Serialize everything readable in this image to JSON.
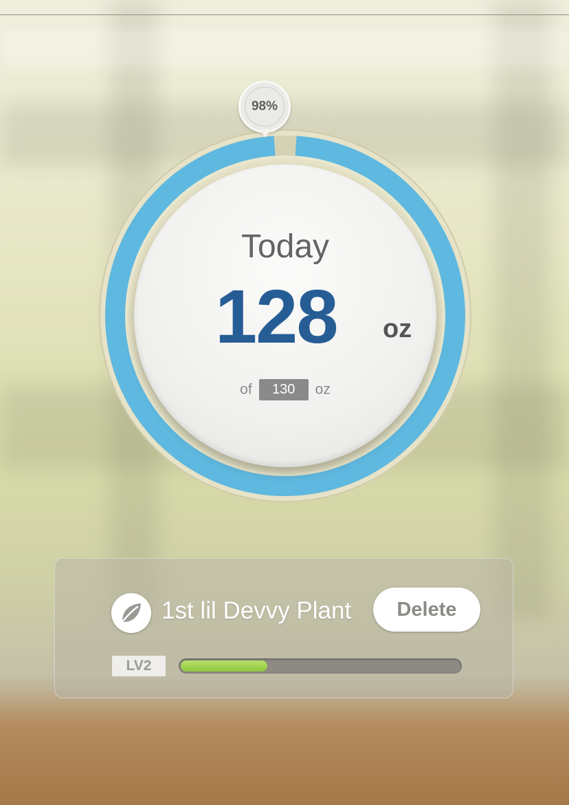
{
  "tracker": {
    "period_label": "Today",
    "amount": "128",
    "unit": "oz",
    "goal_prefix": "of",
    "goal": "130",
    "goal_unit": "oz",
    "percent_label": "98%",
    "progress_fraction": 0.98
  },
  "plant": {
    "icon": "leaf-icon",
    "name": "1st lil Devvy Plant",
    "delete_label": "Delete",
    "level_label": "LV2",
    "level_progress_fraction": 0.31
  },
  "colors": {
    "ring": "#5fb8e0",
    "amount": "#275d95",
    "level_bar": "#8cc63f"
  }
}
